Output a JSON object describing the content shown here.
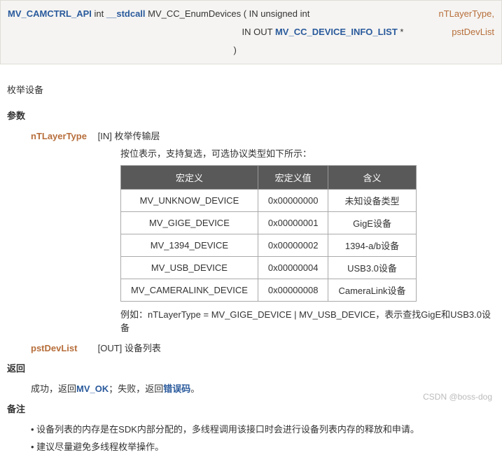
{
  "signature": {
    "api_macro": "MV_CAMCTRL_API",
    "ret_type": " int ",
    "callconv": "__stdcall",
    "func_name": " MV_CC_EnumDevices ( ",
    "p1_prefix": "IN unsigned int",
    "p1_name": "nTLayerType,",
    "p2_prefix": "IN OUT ",
    "p2_type": "MV_CC_DEVICE_INFO_LIST",
    "p2_suffix": " * ",
    "p2_name": "pstDevList",
    "close": ")"
  },
  "desc": "枚举设备",
  "sections": {
    "params": "参数",
    "returns": "返回",
    "notes": "备注"
  },
  "params": {
    "p1": {
      "name": "nTLayerType",
      "brief": "[IN] 枚举传输层",
      "detail": "按位表示，支持复选，可选协议类型如下所示：",
      "example": "例如：nTLayerType = MV_GIGE_DEVICE | MV_USB_DEVICE，表示查找GigE和USB3.0设备"
    },
    "p2": {
      "name": "pstDevList",
      "brief": "[OUT] 设备列表"
    }
  },
  "table": {
    "headers": [
      "宏定义",
      "宏定义值",
      "含义"
    ],
    "rows": [
      [
        "MV_UNKNOW_DEVICE",
        "0x00000000",
        "未知设备类型"
      ],
      [
        "MV_GIGE_DEVICE",
        "0x00000001",
        "GigE设备"
      ],
      [
        "MV_1394_DEVICE",
        "0x00000002",
        "1394-a/b设备"
      ],
      [
        "MV_USB_DEVICE",
        "0x00000004",
        "USB3.0设备"
      ],
      [
        "MV_CAMERALINK_DEVICE",
        "0x00000008",
        "CameraLink设备"
      ]
    ]
  },
  "returns": {
    "prefix": "成功，返回",
    "ok": "MV_OK",
    "mid": "；失败，返回",
    "err": "错误码",
    "suffix": "。"
  },
  "notes": [
    "设备列表的内存是在SDK内部分配的，多线程调用该接口时会进行设备列表内存的释放和申请。",
    "建议尽量避免多线程枚举操作。"
  ],
  "watermark": "CSDN @boss-dog"
}
